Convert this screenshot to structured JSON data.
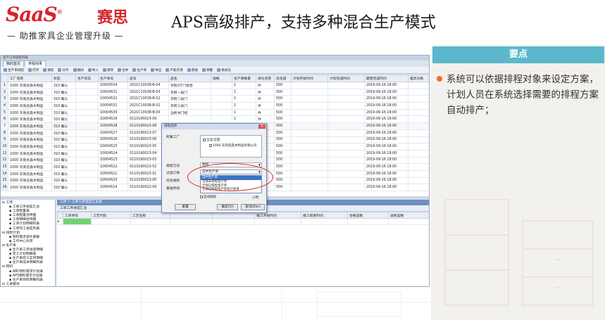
{
  "header": {
    "logo_mark": "SaaS",
    "logo_cn": "赛思",
    "logo_sub": "— 助推家具企业管理升级 —",
    "title": "APS高级排产，支持多种混合生产模式"
  },
  "key_points": {
    "heading": "要点",
    "text": "系统可以依据排程对象来设定方案，计划人员在系统选择需要的排程方案自动排产；"
  },
  "app": {
    "window_title": "生产订单排程列表",
    "tabs": [
      "我的首页",
      "排程结果"
    ],
    "toolbar": [
      "生产单排程",
      "打印",
      "排程",
      "对齐",
      "删除",
      "导入",
      "保存",
      "合并",
      "生产单",
      "导出",
      "产能负荷",
      "帮助",
      "预警",
      "格式化"
    ],
    "grid": {
      "columns": [
        "",
        "工厂名称",
        "状态",
        "生产状态",
        "生产单号",
        "品号",
        "品名",
        "规格",
        "生产单数量",
        "单位名称",
        "优先级",
        "计划开始时间",
        "计划完成时间",
        "期望完成时间",
        "差异天数"
      ],
      "rows": [
        [
          "1",
          "1000 东莞名森木制品",
          "310 确认",
          "",
          "10004534",
          "2021C10038-B-04",
          "衣柜2厅门组合",
          "",
          "1",
          "件",
          "500",
          "",
          "",
          "2019-09-16 18:00",
          ""
        ],
        [
          "2",
          "1000 东莞名森木制品",
          "310 确认",
          "",
          "10004531",
          "2021C10038-B-03",
          "衣柜一层门",
          "",
          "1",
          "件",
          "500",
          "",
          "",
          "2019-09-16 18:00",
          ""
        ],
        [
          "3",
          "1000 东莞名森木制品",
          "310 确认",
          "",
          "10004532",
          "2021C10038-B-02",
          "衣柜二层门",
          "",
          "1",
          "件",
          "500",
          "",
          "",
          "2019-09-16 18:00",
          ""
        ],
        [
          "4",
          "1000 东莞名森木制品",
          "310 确认",
          "",
          "10004531",
          "2021C10038-B-01",
          "衣柜三层门",
          "",
          "1",
          "件",
          "500",
          "",
          "",
          "2019-09-16 18:00",
          ""
        ],
        [
          "5",
          "1000 东莞名森木制品",
          "310 确认",
          "",
          "10004530",
          "2021C10038-B-00",
          "边柜书门组",
          "",
          "1",
          "件",
          "500",
          "",
          "",
          "2019-09-16 18:00",
          ""
        ],
        [
          "6",
          "1000 东莞名森木制品",
          "310 确认",
          "",
          "10004529",
          "0110190023-09",
          "",
          "",
          "1",
          "件",
          "500",
          "",
          "",
          "2019-09-16 18:00",
          ""
        ],
        [
          "7",
          "1000 东莞名森木制品",
          "310 确认",
          "",
          "10004528",
          "0110190023-08",
          "",
          "",
          "1",
          "件",
          "500",
          "",
          "",
          "2019-09-16 18:00",
          ""
        ],
        [
          "8",
          "1000 东莞名森木制品",
          "310 确认",
          "",
          "10004527",
          "0110190023-07",
          "",
          "",
          "1",
          "件",
          "500",
          "",
          "",
          "2019-09-16 18:00",
          ""
        ],
        [
          "9",
          "1000 东莞名森木制品",
          "310 确认",
          "",
          "10004526",
          "0110190023-06",
          "",
          "",
          "1",
          "件",
          "500",
          "",
          "",
          "2019-09-16 18:00",
          ""
        ],
        [
          "10",
          "1000 东莞名森木制品",
          "310 确认",
          "",
          "10004525",
          "0110190023-05",
          "",
          "",
          "1",
          "件",
          "500",
          "",
          "",
          "2019-09-16 18:00",
          ""
        ],
        [
          "11",
          "1000 东莞名森木制品",
          "310 确认",
          "",
          "10004524",
          "0110190023-04",
          "",
          "",
          "1",
          "件",
          "500",
          "",
          "",
          "2019-09-16 18:00",
          ""
        ],
        [
          "12",
          "1000 东莞名森木制品",
          "310 确认",
          "",
          "10004523",
          "0110190023-03",
          "",
          "",
          "1",
          "件",
          "500",
          "",
          "",
          "2019-09-16 18:00",
          ""
        ],
        [
          "13",
          "1000 东莞名森木制品",
          "310 确认",
          "",
          "10004522",
          "0110190023-02",
          "",
          "",
          "1",
          "件",
          "500",
          "",
          "",
          "2019-09-16 18:00",
          ""
        ],
        [
          "14",
          "1000 东莞名森木制品",
          "310 确认",
          "",
          "10004521",
          "0110190023-01",
          "",
          "",
          "1",
          "件",
          "500",
          "",
          "",
          "2019-09-16 18:00",
          ""
        ],
        [
          "15",
          "1000 东莞名森木制品",
          "310 确认",
          "",
          "10004520",
          "0110190023-00",
          "",
          "",
          "1",
          "件",
          "500",
          "",
          "",
          "2019-09-16 18:00",
          ""
        ],
        [
          "16",
          "1000 东莞名森木制品",
          "310 确认",
          "",
          "10004519",
          "0110190022-09",
          "",
          "",
          "1",
          "件",
          "500",
          "",
          "",
          "2019-09-16 18:00",
          ""
        ]
      ],
      "highlight_row": 6
    },
    "tree": [
      {
        "label": "工序",
        "level": 0
      },
      {
        "label": "工单工序进度汇总",
        "level": 1
      },
      {
        "label": "工序配置表",
        "level": 1
      },
      {
        "label": "工序配置甘特图",
        "level": 1
      },
      {
        "label": "工序明细甘特图",
        "level": 1
      },
      {
        "label": "工序计划明细列表",
        "level": 1
      },
      {
        "label": "工序完工进度列表",
        "level": 1
      },
      {
        "label": "排程计划",
        "level": 0
      },
      {
        "label": "物料需求按外部群",
        "level": 1
      },
      {
        "label": "工作中心负荷",
        "level": 1
      },
      {
        "label": "生产单",
        "level": 0
      },
      {
        "label": "生产单工序进度明细",
        "level": 1
      },
      {
        "label": "完工计划明细表",
        "level": 1
      },
      {
        "label": "生产单完工实时明细",
        "level": 1
      },
      {
        "label": "生产单成本明细列表",
        "level": 1
      },
      {
        "label": "物料",
        "level": 0
      },
      {
        "label": "ABC物料需求计划表",
        "level": 1
      },
      {
        "label": "APS物料需求计划表",
        "level": 1
      },
      {
        "label": "生产单领料明细列表",
        "level": 1
      },
      {
        "label": "工单模块",
        "level": 0
      },
      {
        "label": "APS工单需求计划表",
        "level": 1
      }
    ],
    "bottom": {
      "tab": "工序 > 工单工序进度汇总表",
      "subtab": "工单工序进度汇总",
      "columns": [
        "",
        "工序序号",
        "工艺代码",
        "工艺名称",
        "",
        "",
        "报工开始时间",
        "报工结束时间",
        "合格品数",
        "返修品数"
      ]
    },
    "dialog": {
      "title": "排程选项",
      "close": "×",
      "factory_label": "所属工厂",
      "tree_root": "全选/全部",
      "tree_child": "1000 东莞名森木制品有限公司",
      "direction_label": "排程方向",
      "direction_value": "顺排",
      "order_label": "过滤订单",
      "order_value": "选中生产单",
      "priority_label": "优先规则",
      "basetime_label": "基准时间",
      "options": [
        "选中生产单",
        "全部未排程生产单",
        "全部已排程生产单",
        "全部已排程生产单及计划单"
      ],
      "active_option": 0,
      "auto_checkbox": "自动排程",
      "hours_suffix": "小时",
      "reset": "重置",
      "ok": "确定(O)",
      "cancel": "取消(Esc)"
    }
  }
}
